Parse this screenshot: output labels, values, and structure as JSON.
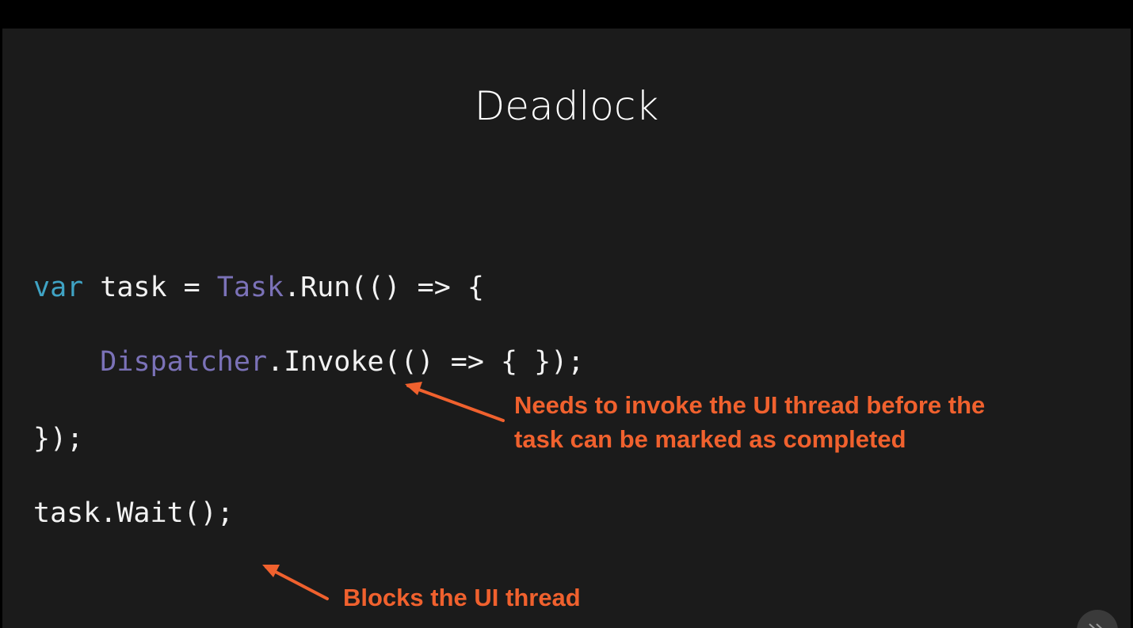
{
  "slide": {
    "title": "Deadlock",
    "code": {
      "line1": {
        "kw": "var",
        "plain1": " task = ",
        "type": "Task",
        "plain2": ".Run(() => {"
      },
      "line2": {
        "indent": "    ",
        "type": "Dispatcher",
        "plain": ".Invoke(() => { });"
      },
      "line3": "});",
      "line4": "task.Wait();"
    },
    "annotations": {
      "invoke_note_line1": "Needs to invoke the UI thread before the",
      "invoke_note_line2": "task can be marked as completed",
      "wait_note": "Blocks the UI thread"
    }
  },
  "colors": {
    "background": "#1b1b1b",
    "keyword": "#3fa3c4",
    "type": "#7b72b8",
    "annotation": "#f0612e",
    "text": "#f2f2f2"
  },
  "icons": {
    "player_control": "play-forward-icon"
  }
}
